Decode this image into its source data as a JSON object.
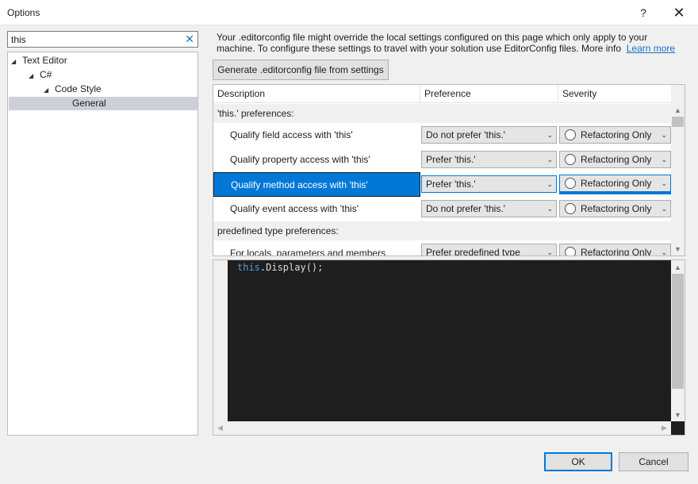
{
  "window": {
    "title": "Options",
    "help": "?",
    "close": "✕"
  },
  "search": {
    "value": "this",
    "clear": "✕"
  },
  "tree": {
    "items": [
      {
        "label": "Text Editor",
        "arrow": "◢"
      },
      {
        "label": "C#",
        "arrow": "◢"
      },
      {
        "label": "Code Style",
        "arrow": "◢"
      },
      {
        "label": "General",
        "arrow": ""
      }
    ]
  },
  "info": {
    "text": "Your .editorconfig file might override the local settings configured on this page which only apply to your machine. To configure these settings to travel with your solution use EditorConfig files. More info",
    "link": "Learn more"
  },
  "generate_button": "Generate .editorconfig file from settings",
  "grid": {
    "columns": [
      "Description",
      "Preference",
      "Severity"
    ],
    "groups": [
      "'this.' preferences:",
      "predefined type preferences:"
    ],
    "rows": [
      {
        "description": "Qualify field access with 'this'",
        "preference": "Do not prefer 'this.'",
        "severity": "Refactoring Only"
      },
      {
        "description": "Qualify property access with 'this'",
        "preference": "Prefer 'this.'",
        "severity": "Refactoring Only"
      },
      {
        "description": "Qualify method access with 'this'",
        "preference": "Prefer 'this.'",
        "severity": "Refactoring Only"
      },
      {
        "description": "Qualify event access with 'this'",
        "preference": "Do not prefer 'this.'",
        "severity": "Refactoring Only"
      },
      {
        "description": "For locals, parameters and members",
        "preference": "Prefer predefined type",
        "severity": "Refactoring Only"
      }
    ]
  },
  "preview": {
    "keyword": "this",
    "rest": ".Display();"
  },
  "buttons": {
    "ok": "OK",
    "cancel": "Cancel"
  },
  "colors": {
    "accent": "#0078d7",
    "link": "#1a6fc4",
    "code_bg": "#1e1e1e",
    "keyword": "#569cd6"
  }
}
